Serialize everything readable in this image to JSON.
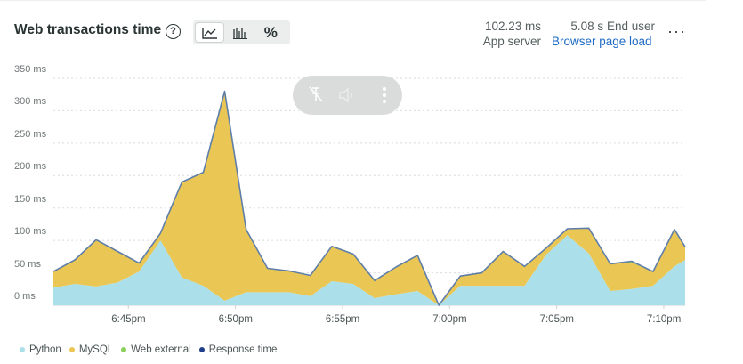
{
  "header": {
    "title": "Web transactions time",
    "help_glyph": "?",
    "toggles": [
      {
        "icon": "area-chart-icon",
        "active": true
      },
      {
        "icon": "histogram-icon",
        "active": false
      },
      {
        "icon": "percent-icon",
        "label": "%",
        "active": false
      }
    ],
    "stats": [
      {
        "value": "102.23 ms",
        "label": "App server",
        "link": false
      },
      {
        "value": "5.08 s",
        "value_suffix": "End user",
        "label": "Browser page load",
        "link": true
      }
    ],
    "more_glyph": "···"
  },
  "colors": {
    "python": "#abe0ea",
    "mysql": "#eac754",
    "web_external": "#8ad05a",
    "response_time": "#1f3d8a",
    "response_line": "#5f7ea8",
    "link": "#1d6ac4"
  },
  "media_overlay": {
    "buttons": [
      "pin-off-icon",
      "volume-icon",
      "more-vertical-icon"
    ]
  },
  "chart_data": {
    "type": "area",
    "stacked": true,
    "y_ticks": [
      "0 ms",
      "50 ms",
      "100 ms",
      "150 ms",
      "200 ms",
      "250 ms",
      "300 ms",
      "350 ms"
    ],
    "ylim": [
      0,
      350
    ],
    "x_tick_labels": [
      "6:45pm",
      "6:50pm",
      "6:55pm",
      "7:00pm",
      "7:05pm",
      "7:10pm"
    ],
    "x_tick_minutes": [
      3.5,
      8.5,
      13.5,
      18.5,
      23.5,
      28.5
    ],
    "xlim": [
      0,
      29.5
    ],
    "grid": "dashed horizontal",
    "x_minutes": [
      0,
      1,
      2,
      3,
      4,
      5,
      6,
      7,
      8,
      9,
      10,
      11,
      12,
      13,
      14,
      15,
      16,
      17,
      18,
      19,
      20,
      21,
      22,
      23,
      24,
      25,
      26,
      27,
      28,
      29,
      29.5
    ],
    "series": [
      {
        "name": "Python",
        "values": [
          27,
          33,
          29,
          35,
          52,
          100,
          43,
          30,
          7,
          20,
          20,
          20,
          14,
          37,
          33,
          11,
          17,
          22,
          0,
          30,
          30,
          30,
          30,
          78,
          108,
          80,
          22,
          25,
          30,
          60,
          70
        ]
      },
      {
        "name": "MySQL",
        "values": [
          25,
          37,
          72,
          48,
          13,
          11,
          147,
          175,
          323,
          97,
          37,
          33,
          32,
          54,
          46,
          27,
          42,
          55,
          0,
          15,
          20,
          53,
          30,
          10,
          10,
          39,
          42,
          41,
          22,
          57,
          20
        ]
      },
      {
        "name": "Web external",
        "values": [
          0,
          0,
          0,
          0,
          0,
          0,
          0,
          0,
          0,
          0,
          0,
          0,
          0,
          0,
          0,
          0,
          0,
          0,
          0,
          0,
          0,
          0,
          0,
          0,
          0,
          0,
          0,
          2,
          0,
          0,
          0
        ]
      },
      {
        "name": "Response time",
        "values": [
          52,
          70,
          101,
          83,
          65,
          111,
          190,
          205,
          330,
          117,
          57,
          53,
          46,
          91,
          79,
          38,
          59,
          77,
          0,
          45,
          50,
          83,
          60,
          88,
          118,
          119,
          64,
          68,
          52,
          117,
          90
        ]
      }
    ],
    "legend": [
      "Python",
      "MySQL",
      "Web external",
      "Response time"
    ],
    "legend_position": "bottom-left"
  }
}
